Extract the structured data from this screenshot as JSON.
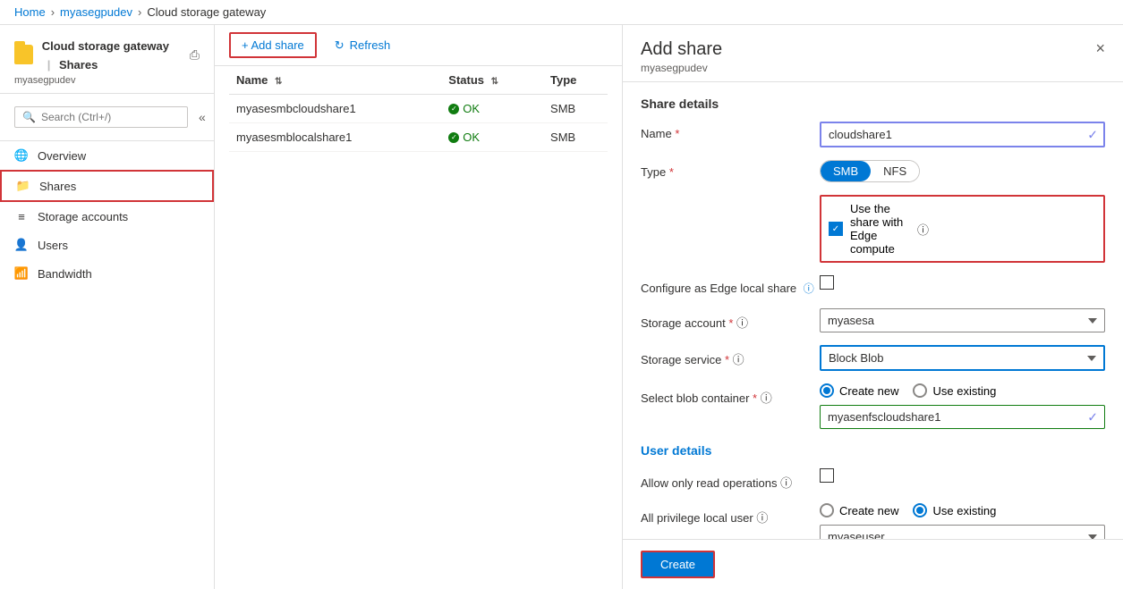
{
  "breadcrumb": {
    "items": [
      "Home",
      "myasegpudev",
      "Cloud storage gateway"
    ]
  },
  "sidebar": {
    "title": "Cloud storage gateway",
    "pipe": "|",
    "section": "Shares",
    "subtitle": "myasegpudev",
    "search_placeholder": "Search (Ctrl+/)",
    "nav_items": [
      {
        "id": "overview",
        "label": "Overview",
        "icon": "globe"
      },
      {
        "id": "shares",
        "label": "Shares",
        "icon": "share",
        "active": true
      },
      {
        "id": "storage-accounts",
        "label": "Storage accounts",
        "icon": "storage"
      },
      {
        "id": "users",
        "label": "Users",
        "icon": "user"
      },
      {
        "id": "bandwidth",
        "label": "Bandwidth",
        "icon": "bandwidth"
      }
    ]
  },
  "toolbar": {
    "add_share_label": "+ Add share",
    "refresh_label": "Refresh"
  },
  "table": {
    "columns": [
      "Name",
      "Status",
      "Type"
    ],
    "rows": [
      {
        "name": "myasesmbcloudshare1",
        "status": "OK",
        "type": "SMB"
      },
      {
        "name": "myasesmblocalshare1",
        "status": "OK",
        "type": "SMB"
      }
    ]
  },
  "panel": {
    "title": "Add share",
    "subtitle": "myasegpudev",
    "close_label": "×",
    "sections": {
      "share_details": "Share details",
      "user_details": "User details"
    },
    "fields": {
      "name_label": "Name",
      "name_required": "*",
      "name_value": "cloudshare1",
      "type_label": "Type",
      "type_required": "*",
      "type_smb": "SMB",
      "type_nfs": "NFS",
      "edge_compute_label": "Use the share with Edge compute",
      "edge_compute_info": "ⓘ",
      "edge_compute_checked": true,
      "edge_local_label": "Configure as Edge local share",
      "edge_local_info": "ⓘ",
      "edge_local_checked": false,
      "storage_account_label": "Storage account",
      "storage_account_required": "*",
      "storage_account_info": "ⓘ",
      "storage_account_value": "myasesa",
      "storage_service_label": "Storage service",
      "storage_service_required": "*",
      "storage_service_info": "ⓘ",
      "storage_service_value": "Block Blob",
      "blob_container_label": "Select blob container",
      "blob_container_required": "*",
      "blob_container_info": "ⓘ",
      "blob_create_new": "Create new",
      "blob_use_existing": "Use existing",
      "blob_selected": "create_new",
      "blob_value": "myasenfscloudshare1",
      "allow_readonly_label": "Allow only read operations",
      "allow_readonly_info": "ⓘ",
      "allow_readonly_checked": false,
      "privilege_label": "All privilege local user",
      "privilege_info": "ⓘ",
      "privilege_create_new": "Create new",
      "privilege_use_existing": "Use existing",
      "privilege_selected": "use_existing",
      "privilege_value": "myaseuser"
    },
    "create_label": "Create"
  }
}
